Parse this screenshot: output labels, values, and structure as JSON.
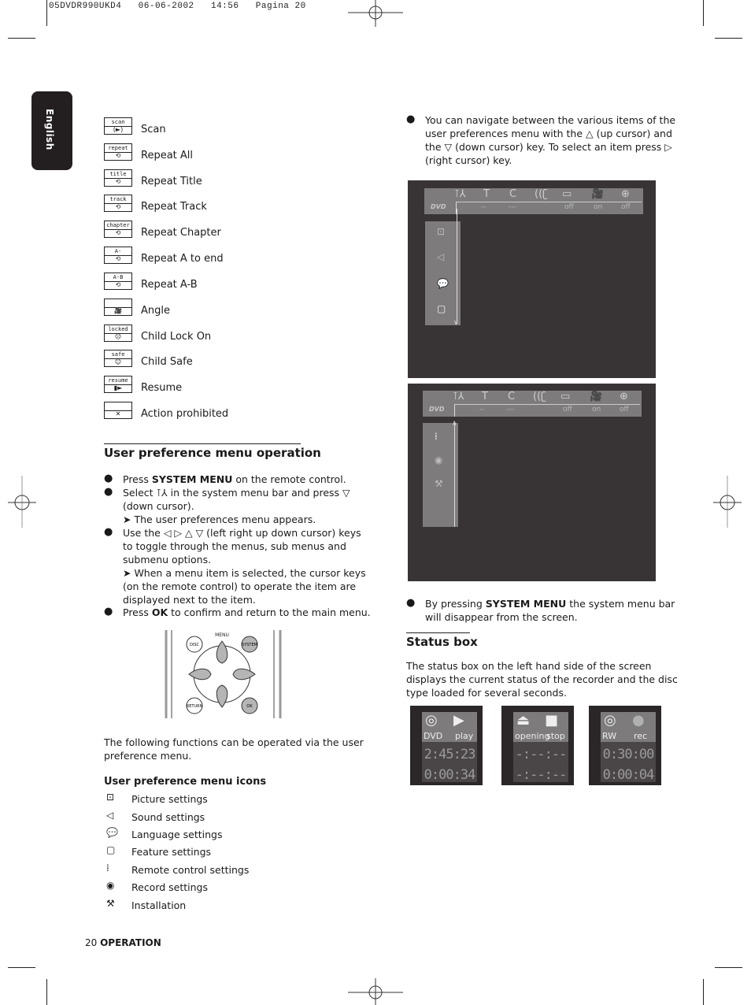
{
  "print_header": {
    "file": "05DVDR990UKD4",
    "date": "06-06-2002",
    "time": "14:56",
    "page": "Pagina 20"
  },
  "language_tab": "English",
  "status_icons": [
    {
      "top": "scan",
      "bottom": "(►)",
      "label": "Scan",
      "icon": "scan-icon"
    },
    {
      "top": "repeat",
      "bottom": "⟲",
      "label": "Repeat All",
      "icon": "repeat-icon"
    },
    {
      "top": "title",
      "bottom": "⟲",
      "label": "Repeat Title",
      "icon": "repeat-title-icon"
    },
    {
      "top": "track",
      "bottom": "⟲",
      "label": "Repeat Track",
      "icon": "repeat-track-icon"
    },
    {
      "top": "chapter",
      "bottom": "⟲",
      "label": "Repeat Chapter",
      "icon": "repeat-chapter-icon"
    },
    {
      "top": "A-",
      "bottom": "⟲",
      "label": "Repeat A to end",
      "icon": "repeat-a-icon"
    },
    {
      "top": "A-B",
      "bottom": "⟲",
      "label": "Repeat A-B",
      "icon": "repeat-ab-icon"
    },
    {
      "top": "",
      "bottom": "🎥",
      "label": "Angle",
      "icon": "angle-icon"
    },
    {
      "top": "locked",
      "bottom": "☹",
      "label": "Child Lock On",
      "icon": "child-lock-icon"
    },
    {
      "top": "safe",
      "bottom": "☺",
      "label": "Child Safe",
      "icon": "child-safe-icon"
    },
    {
      "top": "resume",
      "bottom": "▮►",
      "label": "Resume",
      "icon": "resume-icon"
    },
    {
      "top": "",
      "bottom": "✕",
      "label": "Action prohibited",
      "icon": "prohibited-icon"
    }
  ],
  "operation": {
    "title": "User preference menu operation",
    "b1_pre": "Press ",
    "b1_bold": "SYSTEM MENU",
    "b1_post": " on the remote control.",
    "b2_line1": "Select ⊺⅄ in the system menu bar and press ▽",
    "b2_line2": "(down cursor).",
    "b2_sub": "➤ The user preferences menu appears.",
    "b3_line1": "Use the ◁ ▷ △ ▽ (left right up down cursor) keys",
    "b3_line2": "to toggle through the menus, sub menus and",
    "b3_line3": "submenu options.",
    "b3_sub1": "➤ When a menu item is selected, the cursor keys",
    "b3_sub2": "(on the remote control) to operate the item are",
    "b3_sub3": "displayed next to the item.",
    "b4_pre": "Press ",
    "b4_bold": "OK",
    "b4_post": " to confirm and return to the main menu."
  },
  "remote": {
    "menu_label": "MENU",
    "disc": "DISC",
    "system": "SYSTEM",
    "return": "RETURN",
    "ok": "OK"
  },
  "functions_intro_1": "The following functions can be operated via the user",
  "functions_intro_2": "preference menu.",
  "pref_icons_title": "User preference menu icons",
  "pref_icons": [
    {
      "glyph": "⊡",
      "label": "Picture settings",
      "icon": "picture-settings-icon"
    },
    {
      "glyph": "◁",
      "label": "Sound settings",
      "icon": "sound-settings-icon"
    },
    {
      "glyph": "💬",
      "label": "Language settings",
      "icon": "language-settings-icon"
    },
    {
      "glyph": "▢",
      "label": "Feature settings",
      "icon": "feature-settings-icon"
    },
    {
      "glyph": "⁞",
      "label": "Remote control settings",
      "icon": "remote-settings-icon"
    },
    {
      "glyph": "◉",
      "label": "Record settings",
      "icon": "record-settings-icon"
    },
    {
      "glyph": "⚒",
      "label": "Installation",
      "icon": "installation-icon"
    }
  ],
  "footer": {
    "page_num": "20",
    "section": "OPERATION"
  },
  "navigate": {
    "l1": "You can navigate between the various items of the",
    "l2": "user preferences menu with the △ (up cursor) and",
    "l3": "the ▽ (down cursor) key. To select an item press ▷",
    "l4": "(right cursor) key."
  },
  "menu_bar": {
    "icons": [
      "⊺⅄",
      "T",
      "C",
      "((ʗ",
      "▭",
      "🎥",
      "⊕"
    ],
    "disc": "DVD",
    "values": [
      "--",
      "---",
      "",
      "off",
      "on",
      "off"
    ]
  },
  "screen1_side": [
    "⊡",
    "◁",
    "💬",
    "▢"
  ],
  "screen2_side": [
    "⁞",
    "◉",
    "⚒"
  ],
  "system_menu_note": {
    "pre": "By pressing ",
    "bold": "SYSTEM MENU",
    "post1": " the system menu bar",
    "post2": "will disappear from the screen."
  },
  "status_box": {
    "title": "Status box",
    "l1": "The status box on the left hand side of the screen",
    "l2": "displays the current status of the recorder and the disc",
    "l3": "type loaded for several seconds.",
    "boxes": [
      {
        "disc": "DVD",
        "state": "play",
        "time1": "2:45:23",
        "time2": "0:00:34"
      },
      {
        "disc": "opening",
        "state": "stop",
        "time1": "-:--:--",
        "time2": "-:--:--"
      },
      {
        "disc": "RW",
        "state": "rec",
        "time1": "0:30:00",
        "time2": "0:00:04"
      }
    ]
  }
}
